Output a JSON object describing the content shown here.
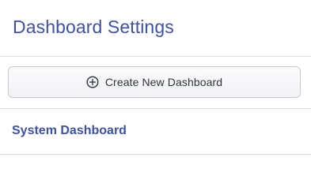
{
  "header": {
    "title": "Dashboard Settings"
  },
  "actions": {
    "create_label": "Create New Dashboard",
    "create_icon": "plus-circle-icon"
  },
  "dashboards": [
    {
      "label": "System Dashboard"
    }
  ],
  "colors": {
    "accent": "#3f51a5",
    "button_text": "#2f3440",
    "divider": "#dcdde1"
  }
}
